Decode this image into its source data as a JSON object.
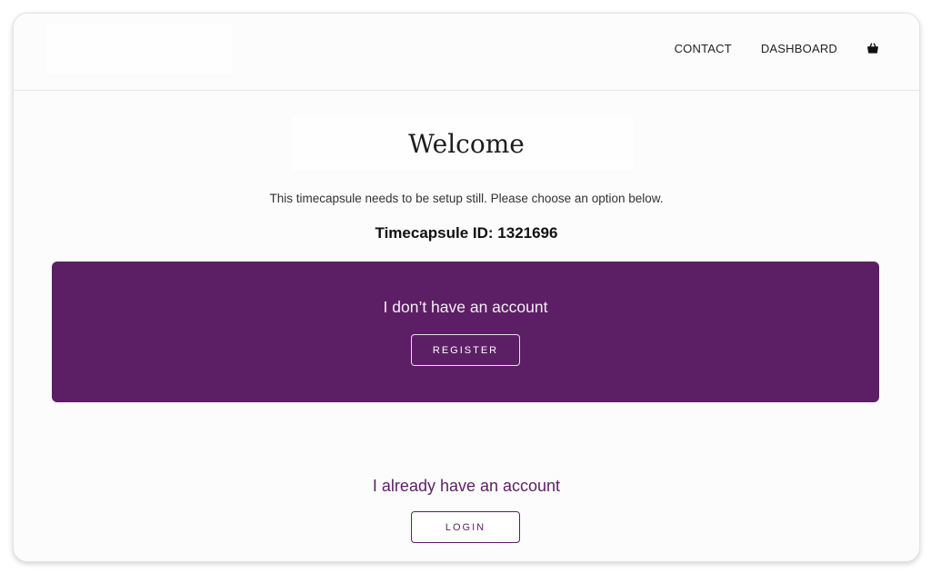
{
  "nav": {
    "contact_label": "CONTACT",
    "dashboard_label": "DASHBOARD",
    "cart_icon": "shopping-basket-icon"
  },
  "main": {
    "title": "Welcome",
    "subtitle": "This timecapsule needs to be setup still. Please choose an option below.",
    "capsule_id_text": "Timecapsule ID: 1321696"
  },
  "register_panel": {
    "heading": "I don’t have an account",
    "button_label": "REGISTER"
  },
  "login_section": {
    "heading": "I already have an account",
    "button_label": "LOGIN"
  },
  "colors": {
    "accent": "#5c1f65",
    "background": "#fcfcfc"
  }
}
